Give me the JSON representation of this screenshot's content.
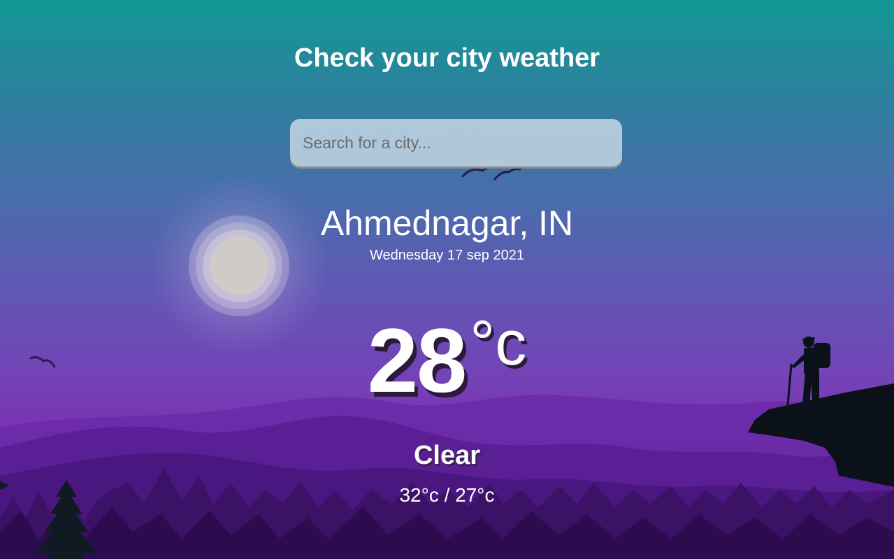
{
  "header": {
    "title": "Check your city weather"
  },
  "search": {
    "placeholder": "Search for a city...",
    "value": ""
  },
  "location": {
    "city": "Ahmednagar, IN",
    "date": "Wednesday 17 sep 2021"
  },
  "current": {
    "temperature": "28",
    "unit": "°c",
    "condition": "Clear",
    "high_low": "32°c / 27°c"
  },
  "colors": {
    "gradient_top": "#129893",
    "gradient_mid": "#6157b4",
    "gradient_bottom": "#7b2fb0",
    "text": "#ffffff"
  },
  "icons": [
    "sun-icon",
    "bird-icon",
    "hiker-silhouette",
    "mountain-silhouette",
    "pine-tree-silhouette"
  ]
}
